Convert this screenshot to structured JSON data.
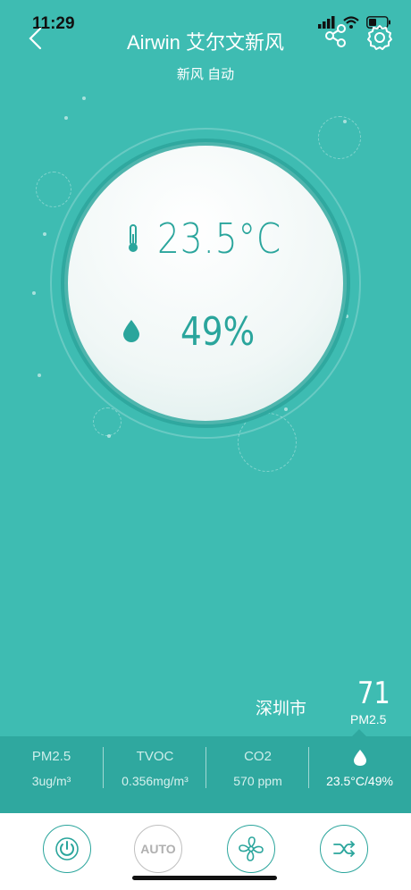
{
  "status_bar": {
    "time": "11:29"
  },
  "header": {
    "title": "Airwin 艾尔文新风",
    "subtitle": "新风 自动"
  },
  "readings": {
    "temperature": "23.5°C",
    "humidity": "49%"
  },
  "location": {
    "city": "深圳市",
    "pm_value": "71",
    "pm_label": "PM2.5"
  },
  "metrics": [
    {
      "label": "PM2.5",
      "value": "3ug/m³"
    },
    {
      "label": "TVOC",
      "value": "0.356mg/m³"
    },
    {
      "label": "CO2",
      "value": "570 ppm"
    },
    {
      "label": "",
      "value": "23.5°C/49%"
    }
  ],
  "controls": {
    "auto_label": "AUTO"
  },
  "colors": {
    "background": "#3ebcb2",
    "accent": "#2aa59c",
    "panel": "#2fa89f"
  }
}
